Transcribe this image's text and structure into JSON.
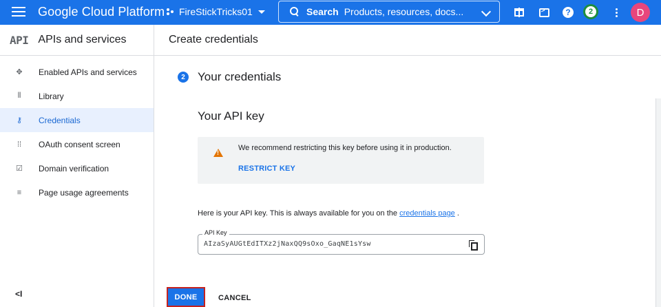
{
  "header": {
    "brand": "Google Cloud Platform",
    "project": "FireStickTricks01",
    "search_label": "Search",
    "search_placeholder": "Products, resources, docs...",
    "notification_count": "2",
    "avatar_initial": "D"
  },
  "sidebar": {
    "logo": "API",
    "title": "APIs and services",
    "items": [
      {
        "label": "Enabled APIs and services",
        "icon": "diamond-dots-icon"
      },
      {
        "label": "Library",
        "icon": "library-icon"
      },
      {
        "label": "Credentials",
        "icon": "key-icon",
        "active": true
      },
      {
        "label": "OAuth consent screen",
        "icon": "oauth-icon"
      },
      {
        "label": "Domain verification",
        "icon": "checkbox-icon"
      },
      {
        "label": "Page usage agreements",
        "icon": "settings-list-icon"
      }
    ],
    "collapse_label": "<I"
  },
  "main": {
    "title": "Create credentials",
    "step_number": "2",
    "step_title": "Your credentials",
    "key_title": "Your API key",
    "warning_text": "We recommend restricting this key before using it in production.",
    "restrict_label": "RESTRICT KEY",
    "info_text": "Here is your API key. This is always available for you on the",
    "info_link": "credentials page",
    "info_suffix": ".",
    "key_label": "API Key",
    "key_value": "AIzaSyAUGtEdITXz2jNaxQQ9sOxo_GaqNE1sYsw",
    "done_label": "DONE",
    "cancel_label": "CANCEL"
  },
  "colors": {
    "primary": "#1a73e8",
    "warning": "#e37400",
    "highlight_border": "#c5221f",
    "avatar": "#e8467c",
    "badge": "#1e8e3e"
  }
}
